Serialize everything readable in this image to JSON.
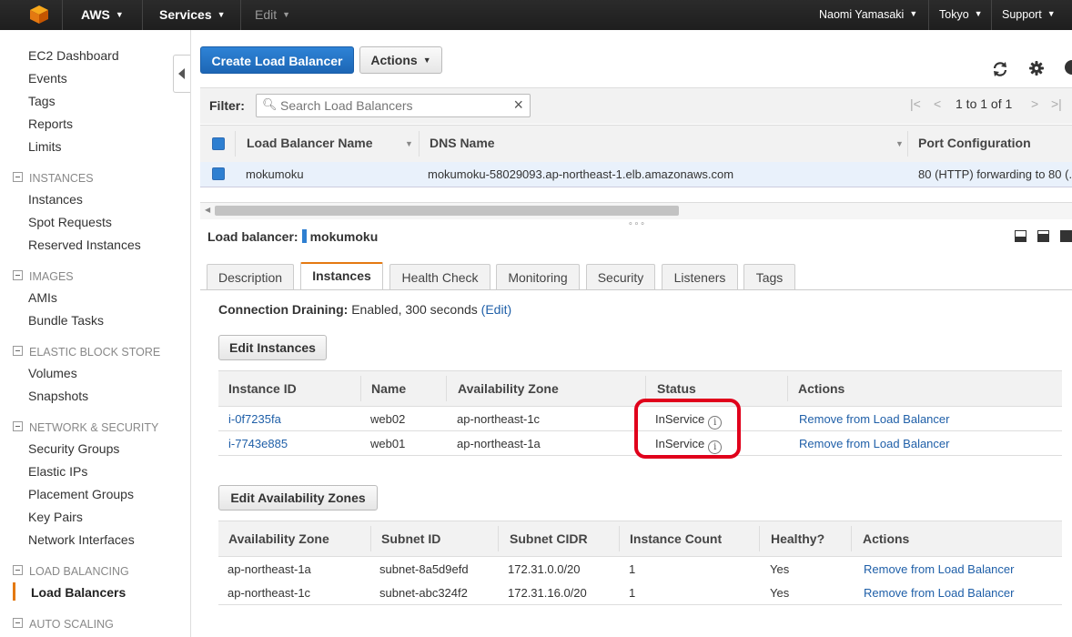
{
  "topbar": {
    "brand": "AWS",
    "services": "Services",
    "edit": "Edit",
    "user": "Naomi Yamasaki",
    "region": "Tokyo",
    "support": "Support"
  },
  "sidebar": {
    "items": [
      {
        "label": "EC2 Dashboard"
      },
      {
        "label": "Events"
      },
      {
        "label": "Tags"
      },
      {
        "label": "Reports"
      },
      {
        "label": "Limits"
      }
    ],
    "sections": [
      {
        "title": "INSTANCES",
        "items": [
          "Instances",
          "Spot Requests",
          "Reserved Instances"
        ]
      },
      {
        "title": "IMAGES",
        "items": [
          "AMIs",
          "Bundle Tasks"
        ]
      },
      {
        "title": "ELASTIC BLOCK STORE",
        "items": [
          "Volumes",
          "Snapshots"
        ]
      },
      {
        "title": "NETWORK & SECURITY",
        "items": [
          "Security Groups",
          "Elastic IPs",
          "Placement Groups",
          "Key Pairs",
          "Network Interfaces"
        ]
      },
      {
        "title": "LOAD BALANCING",
        "items": [
          "Load Balancers"
        ]
      },
      {
        "title": "AUTO SCALING",
        "items": []
      }
    ],
    "active": "Load Balancers",
    "accent": "#e47911"
  },
  "toolbar": {
    "create_label": "Create Load Balancer",
    "actions_label": "Actions"
  },
  "filter": {
    "label": "Filter:",
    "placeholder": "Search Load Balancers",
    "pagination": "1 to 1 of 1"
  },
  "grid": {
    "columns": [
      "Load Balancer Name",
      "DNS Name",
      "Port Configuration"
    ],
    "rows": [
      {
        "name": "mokumoku",
        "dns": "mokumoku-58029093.ap-northeast-1.elb.amazonaws.com",
        "port": "80 (HTTP) forwarding to 80 (..."
      }
    ]
  },
  "details": {
    "label": "Load balancer:",
    "name": "mokumoku",
    "tabs": [
      "Description",
      "Instances",
      "Health Check",
      "Monitoring",
      "Security",
      "Listeners",
      "Tags"
    ],
    "active_tab": "Instances",
    "draining_label": "Connection Draining:",
    "draining_value": "Enabled, 300 seconds",
    "draining_edit": "(Edit)",
    "edit_instances": "Edit Instances",
    "instances": {
      "columns": [
        "Instance ID",
        "Name",
        "Availability Zone",
        "Status",
        "Actions"
      ],
      "rows": [
        {
          "id": "i-0f7235fa",
          "name": "web02",
          "zone": "ap-northeast-1c",
          "status": "InService",
          "action": "Remove from Load Balancer"
        },
        {
          "id": "i-7743e885",
          "name": "web01",
          "zone": "ap-northeast-1a",
          "status": "InService",
          "action": "Remove from Load Balancer"
        }
      ]
    },
    "edit_zones": "Edit Availability Zones",
    "zones": {
      "columns": [
        "Availability Zone",
        "Subnet ID",
        "Subnet CIDR",
        "Instance Count",
        "Healthy?",
        "Actions"
      ],
      "rows": [
        {
          "zone": "ap-northeast-1a",
          "subnet": "subnet-8a5d9efd",
          "cidr": "172.31.0.0/20",
          "count": "1",
          "healthy": "Yes",
          "action": "Remove from Load Balancer"
        },
        {
          "zone": "ap-northeast-1c",
          "subnet": "subnet-abc324f2",
          "cidr": "172.31.16.0/20",
          "count": "1",
          "healthy": "Yes",
          "action": "Remove from Load Balancer"
        }
      ]
    }
  },
  "highlight_color": "#e0001b",
  "link_color": "#1f5fa8"
}
